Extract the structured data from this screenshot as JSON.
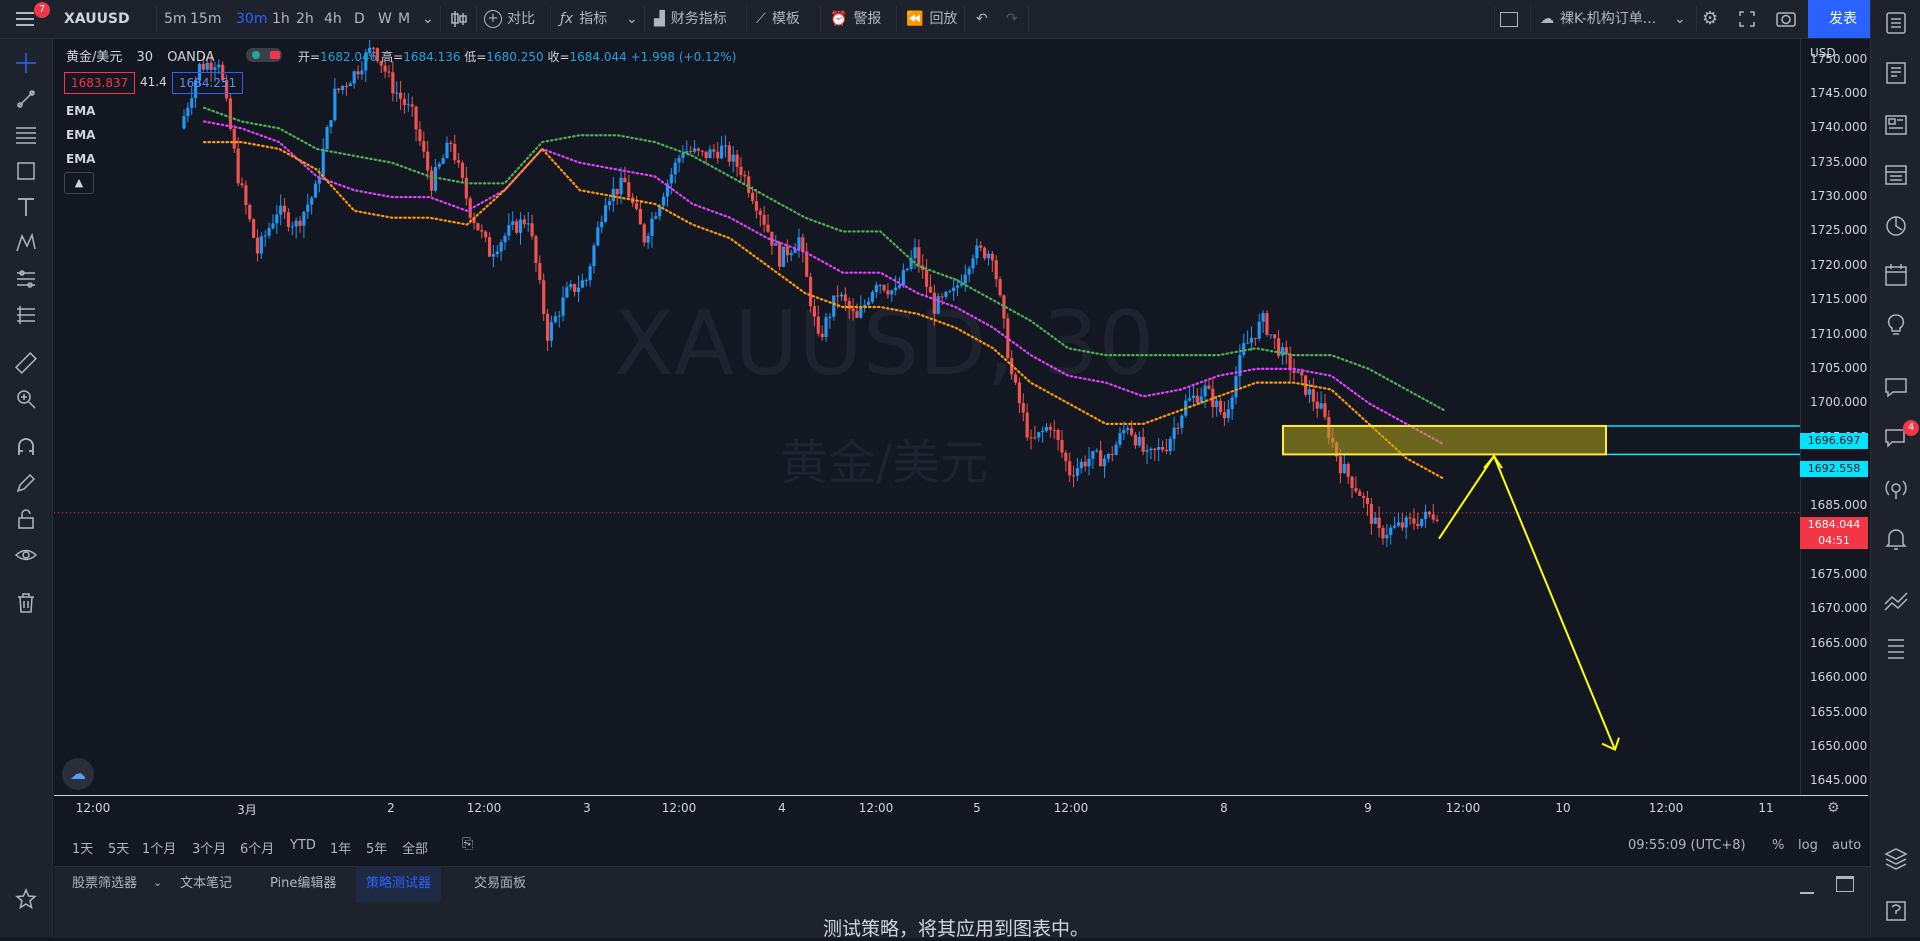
{
  "topbar": {
    "menu_badge": "7",
    "symbol": "XAUUSD",
    "timeframes": [
      "5m",
      "15m",
      "30m",
      "1h",
      "2h",
      "4h",
      "D",
      "W",
      "M"
    ],
    "active_timeframe": "30m",
    "compare_label": "对比",
    "indicators_label": "指标",
    "financials_label": "财务指标",
    "templates_label": "模板",
    "alert_label": "警报",
    "replay_label": "回放",
    "layout_name": "裸K-机构订单...",
    "publish_label": "发表"
  },
  "legend": {
    "title": "黄金/美元",
    "interval": "30",
    "exchange": "OANDA",
    "open_label": "开=",
    "open": "1682.046",
    "high_label": "高=",
    "high": "1684.136",
    "low_label": "低=",
    "low": "1680.250",
    "close_label": "收=",
    "close": "1684.044",
    "change": "+1.998 (+0.12%)",
    "bid": "1683.837",
    "spread": "41.4",
    "ask": "1684.251",
    "indicators": [
      "EMA",
      "EMA",
      "EMA"
    ]
  },
  "watermark": {
    "symbol": "XAUUSD, 30",
    "name": "黄金/美元"
  },
  "price_axis": {
    "currency": "USD",
    "ticks": [
      "1750.000",
      "1745.000",
      "1740.000",
      "1735.000",
      "1730.000",
      "1725.000",
      "1720.000",
      "1715.000",
      "1710.000",
      "1705.000",
      "1700.000",
      "1695.000",
      "1690.000",
      "1685.000",
      "1680.000",
      "1675.000",
      "1670.000",
      "1665.000",
      "1660.000",
      "1655.000",
      "1650.000",
      "1645.000"
    ],
    "zone_top_label": "1696.697",
    "zone_bottom_label": "1692.558",
    "last_price_label": "1684.044",
    "countdown": "04:51"
  },
  "time_axis": {
    "labels": [
      "12:00",
      "3月",
      "2",
      "12:00",
      "3",
      "12:00",
      "4",
      "12:00",
      "5",
      "12:00",
      "8",
      "9",
      "12:00",
      "10",
      "12:00",
      "11"
    ]
  },
  "range_bar": {
    "ranges": [
      "1天",
      "5天",
      "1个月",
      "3个月",
      "6个月",
      "YTD",
      "1年",
      "5年",
      "全部"
    ],
    "clock": "09:55:09 (UTC+8)",
    "percent": "%",
    "log": "log",
    "auto": "auto"
  },
  "bottom_panel": {
    "tabs": [
      "股票筛选器",
      "文本笔记",
      "Pine编辑器",
      "策略测试器",
      "交易面板"
    ],
    "active_tab": "策略测试器",
    "message": "测试策略，将其应用到图表中。"
  },
  "right_toolbar": {
    "notif_badge": "4"
  },
  "colors": {
    "background": "#131722",
    "up": "#2196f3",
    "down": "#ef5350",
    "ema_fast": "#ff9800",
    "ema_mid": "#e040fb",
    "ema_slow": "#4caf50",
    "zone_fill": "#b5a51b",
    "zone_border": "#ffeb3b",
    "zone_lines": "#00e5ff",
    "arrow": "#ffff00",
    "accent": "#2962ff"
  },
  "chart_data": {
    "type": "candlestick",
    "symbol": "XAUUSD",
    "interval": "30",
    "ylim": [
      1643,
      1753
    ],
    "x_ticks": [
      "12:00",
      "3月",
      "2",
      "12:00",
      "3",
      "12:00",
      "4",
      "12:00",
      "5",
      "12:00",
      "8",
      "9",
      "12:00",
      "10",
      "12:00",
      "11"
    ],
    "close_path": [
      1740,
      1749,
      1750,
      1733,
      1722,
      1728,
      1726,
      1731,
      1745,
      1748,
      1752,
      1746,
      1742,
      1732,
      1738,
      1728,
      1722,
      1725,
      1727,
      1710,
      1716,
      1718,
      1730,
      1732,
      1724,
      1731,
      1737,
      1736,
      1737,
      1734,
      1728,
      1721,
      1724,
      1709,
      1716,
      1712,
      1718,
      1716,
      1722,
      1714,
      1716,
      1722,
      1722,
      1704,
      1694,
      1697,
      1690,
      1692,
      1692,
      1697,
      1692,
      1694,
      1700,
      1702,
      1698,
      1708,
      1712,
      1707,
      1703,
      1699,
      1691,
      1687,
      1681,
      1682,
      1683,
      1684.044
    ],
    "ema_fast_path": [
      1738,
      1738,
      1737,
      1734,
      1728,
      1727,
      1727,
      1726,
      1731,
      1737,
      1731,
      1730,
      1729,
      1726,
      1724,
      1720,
      1716,
      1714,
      1714,
      1713,
      1711,
      1708,
      1703,
      1700,
      1697,
      1697,
      1699,
      1701,
      1703,
      1703,
      1702,
      1697,
      1692,
      1689
    ],
    "ema_mid_path": [
      1741,
      1740,
      1738,
      1733,
      1731,
      1730,
      1730,
      1728,
      1731,
      1737,
      1735,
      1734,
      1733,
      1729,
      1727,
      1724,
      1722,
      1719,
      1719,
      1716,
      1714,
      1711,
      1707,
      1704,
      1703,
      1701,
      1702,
      1704,
      1705,
      1705,
      1704,
      1700,
      1697,
      1694
    ],
    "ema_slow_path": [
      1743,
      1741,
      1740,
      1737,
      1736,
      1735,
      1733,
      1732,
      1732,
      1738,
      1739,
      1739,
      1738,
      1736,
      1733,
      1730,
      1727,
      1725,
      1725,
      1720,
      1718,
      1715,
      1712,
      1708,
      1707,
      1707,
      1707,
      1707,
      1708,
      1707,
      1707,
      1705,
      1702,
      1699
    ],
    "zone": {
      "top": 1696.697,
      "bottom": 1692.558
    },
    "last_price": 1684.044
  }
}
